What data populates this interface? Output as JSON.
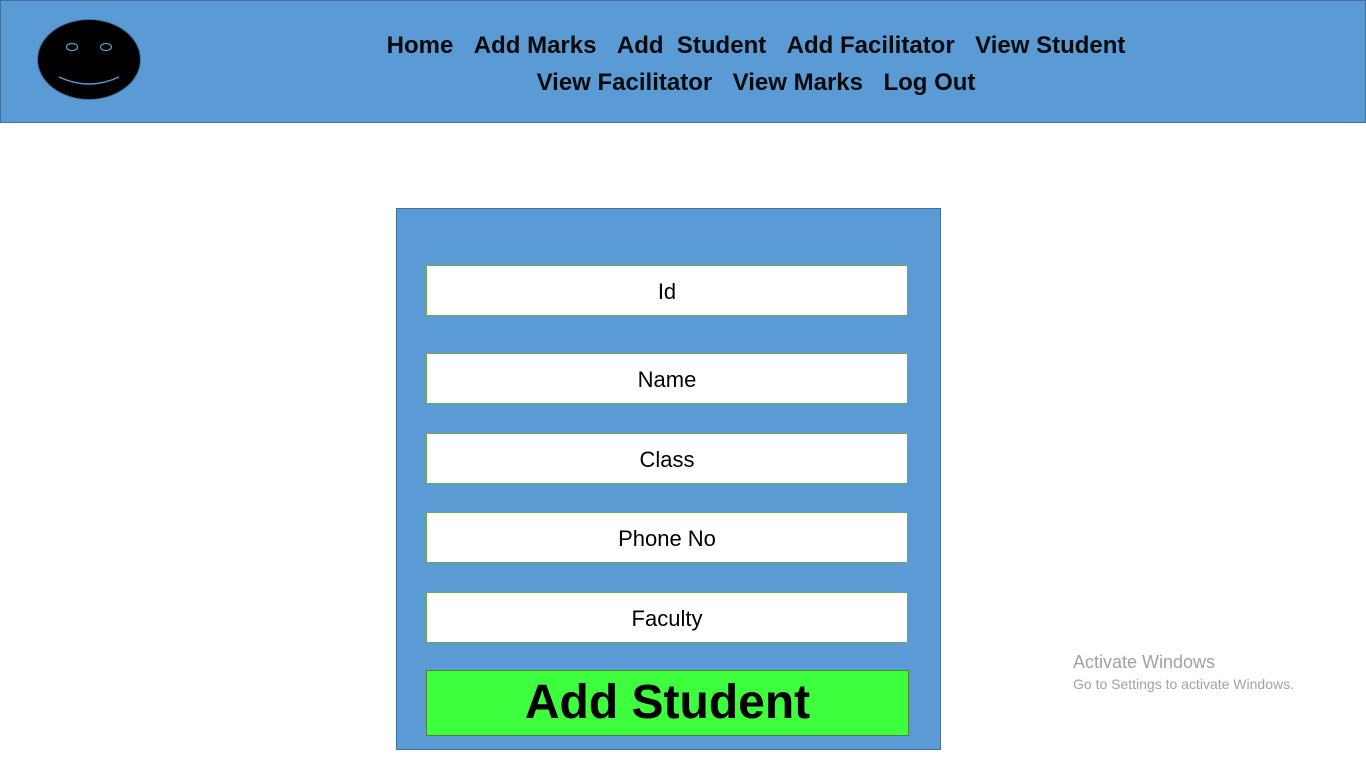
{
  "header": {
    "logo_icon": "smiley-face-icon",
    "background_color": "#5b9bd5",
    "nav": [
      {
        "label": "Home"
      },
      {
        "label": "Add Marks"
      },
      {
        "label": "Add  Student"
      },
      {
        "label": "Add Facilitator"
      },
      {
        "label": "View Student"
      },
      {
        "label": "View Facilitator"
      },
      {
        "label": "View Marks"
      },
      {
        "label": "Log Out"
      }
    ]
  },
  "form": {
    "fields": [
      {
        "label": "Id"
      },
      {
        "label": "Name"
      },
      {
        "label": "Class"
      },
      {
        "label": "Phone No"
      },
      {
        "label": "Faculty"
      }
    ],
    "submit_label": "Add Student",
    "submit_color": "#3dff3d"
  },
  "watermark": {
    "title": "Activate Windows",
    "subtitle": "Go to Settings to activate Windows."
  }
}
